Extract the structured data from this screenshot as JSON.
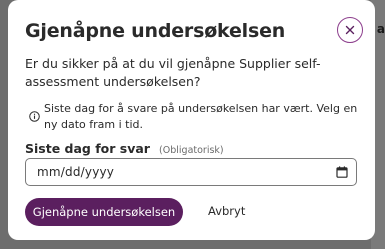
{
  "backdrop": {
    "peek_text": "a"
  },
  "dialog": {
    "title": "Gjenåpne undersøkelsen",
    "close_icon": "close-icon",
    "question": "Er du sikker på at du vil gjenåpne Supplier self-assessment undersøkelsen?",
    "info_icon": "info-icon",
    "info_text": "Siste dag for å svare på undersøkelsen har vært. Velg en ny dato fram i tid.",
    "date_field": {
      "label": "Siste dag for svar",
      "required_hint": "(Obligatorisk)",
      "placeholder": "mm/dd/yyyy",
      "icon": "calendar-icon"
    },
    "buttons": {
      "confirm": "Gjenåpne undersøkelsen",
      "cancel": "Avbryt"
    }
  },
  "colors": {
    "accent": "#5b1f5f",
    "close_border": "#8c3d8c",
    "overlay": "#6d6d6d"
  }
}
